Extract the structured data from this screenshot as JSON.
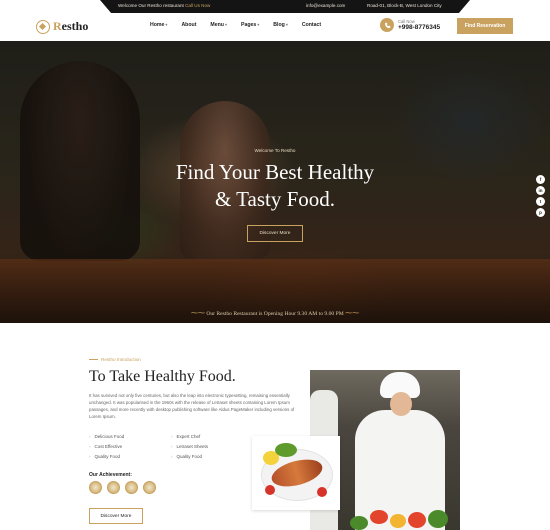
{
  "topbar": {
    "welcome": "Welcome Our Restho restaurant",
    "welcome_accent": "Call Us Now",
    "email": "info@example.com",
    "address": "Road-01, Block-B, West London City"
  },
  "header": {
    "logo": {
      "prefix": "R",
      "rest": "estho",
      "icon": "logo-mark-icon"
    },
    "nav": [
      {
        "label": "Home",
        "dropdown": true
      },
      {
        "label": "About",
        "dropdown": false
      },
      {
        "label": "Menu",
        "dropdown": true
      },
      {
        "label": "Pages",
        "dropdown": true
      },
      {
        "label": "Blog",
        "dropdown": true
      },
      {
        "label": "Contact",
        "dropdown": false
      }
    ],
    "phone_label": "Call Now",
    "phone_number": "+998-8776345",
    "reserve_label": "Find Reservation"
  },
  "hero": {
    "kicker": "Welcome To Restho",
    "title_line1": "Find Your Best Healthy",
    "title_line2": "& Tasty Food.",
    "button": "Discover More",
    "opening": "Our Restho Restaurant is Opening Hour 9.30 AM to 9.00 PM",
    "social": [
      "f",
      "in",
      "t",
      "p"
    ]
  },
  "intro": {
    "kicker": "Restho Introduction",
    "title": "To Take Healthy Food.",
    "paragraph": "It has survived not only five centuries, but also the leap into electronic typesetting, remaining essentially unchanged. It was popularised in the 1960s with the release of Letraset sheets containing Lorem Ipsum passages, and more recently with desktop publishing software like Aldus PageMaker including versions of Lorem Ipsum.",
    "features": [
      "Delicious Food",
      "Expert Chef",
      "Cost Effective",
      "Letraset Sheets",
      "Quality Food",
      "Quality Food"
    ],
    "achievement_label": "Our Achievement:",
    "badge_count": 4,
    "button": "Discover More"
  },
  "colors": {
    "accent": "#c9a25f",
    "dark": "#141414"
  }
}
